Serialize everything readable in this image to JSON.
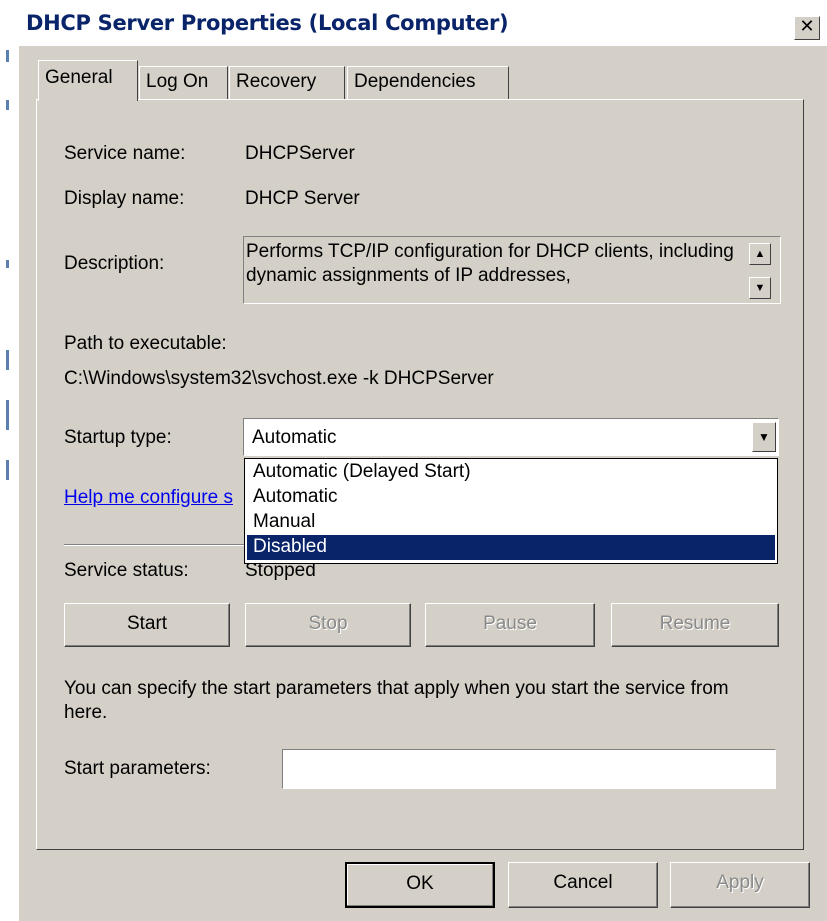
{
  "window": {
    "title": "DHCP Server Properties (Local Computer)",
    "close_glyph": "✕"
  },
  "tabs": [
    {
      "label": "General",
      "active": true
    },
    {
      "label": "Log On",
      "active": false
    },
    {
      "label": "Recovery",
      "active": false
    },
    {
      "label": "Dependencies",
      "active": false
    }
  ],
  "general": {
    "service_name_label": "Service name:",
    "service_name": "DHCPServer",
    "display_name_label": "Display name:",
    "display_name": "DHCP Server",
    "description_label": "Description:",
    "description": "Performs TCP/IP configuration for DHCP clients, including dynamic assignments of IP addresses,",
    "path_label": "Path to executable:",
    "path": "C:\\Windows\\system32\\svchost.exe -k DHCPServer",
    "startup_label": "Startup type:",
    "startup_value": "Automatic",
    "startup_options": [
      "Automatic (Delayed Start)",
      "Automatic",
      "Manual",
      "Disabled"
    ],
    "startup_highlighted": "Disabled",
    "help_link": "Help me configure s",
    "status_label": "Service status:",
    "status_value": "Stopped",
    "buttons": {
      "start": "Start",
      "stop": "Stop",
      "pause": "Pause",
      "resume": "Resume"
    },
    "params_hint": "You can specify the start parameters that apply when you start the service from here.",
    "params_label": "Start parameters:",
    "params_value": ""
  },
  "footer": {
    "ok": "OK",
    "cancel": "Cancel",
    "apply": "Apply"
  },
  "icons": {
    "scroll_up": "scroll-up-arrow",
    "scroll_down": "scroll-down-arrow",
    "combo": "chevron-down"
  },
  "colors": {
    "face": "#d4d0c8",
    "title_text": "#0a246a",
    "selection": "#0a246a",
    "link": "#0000ee"
  }
}
